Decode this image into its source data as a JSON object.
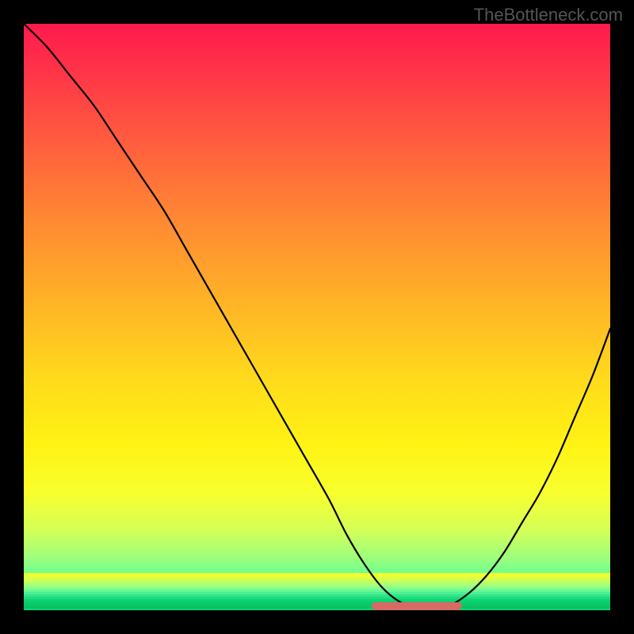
{
  "watermark": "TheBottleneck.com",
  "chart_data": {
    "type": "line",
    "title": "",
    "xlabel": "",
    "ylabel": "",
    "xlim": [
      0,
      100
    ],
    "ylim": [
      0,
      100
    ],
    "grid": false,
    "series": [
      {
        "name": "bottleneck-curve",
        "color": "#000000",
        "x": [
          0,
          4,
          8,
          12,
          16,
          20,
          24,
          28,
          32,
          36,
          40,
          44,
          48,
          52,
          55,
          58,
          61,
          64,
          67,
          70,
          73,
          76,
          79,
          82,
          85,
          88,
          91,
          94,
          97,
          100
        ],
        "y": [
          100,
          96,
          91,
          86,
          80,
          74,
          68,
          61,
          54,
          47,
          40,
          33,
          26,
          19,
          13,
          8,
          4,
          1.5,
          0.5,
          0.3,
          1,
          3,
          6,
          10,
          15,
          20,
          26,
          33,
          40,
          48
        ]
      }
    ],
    "highlight": {
      "name": "optimal-range",
      "color": "#d86a63",
      "x_range": [
        60,
        74
      ],
      "y": 0.7
    },
    "gradient_stops": [
      {
        "pos": 0,
        "color": "#ff1a4d"
      },
      {
        "pos": 50,
        "color": "#ffdd1e"
      },
      {
        "pos": 85,
        "color": "#e6ff4a"
      },
      {
        "pos": 100,
        "color": "#0bd36d"
      }
    ]
  }
}
